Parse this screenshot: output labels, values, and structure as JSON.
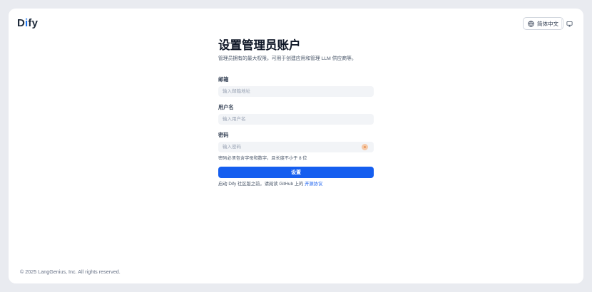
{
  "header": {
    "logo_prefix": "D",
    "logo_accent": "i",
    "logo_suffix": "fy",
    "language_label": "简体中文"
  },
  "form": {
    "title": "设置管理员账户",
    "subtitle": "管理员拥有的最大权限，可用于创建应用和管理 LLM 供应商等。",
    "email": {
      "label": "邮箱",
      "placeholder": "输入邮箱地址",
      "value": ""
    },
    "username": {
      "label": "用户名",
      "placeholder": "输入用户名",
      "value": ""
    },
    "password": {
      "label": "密码",
      "placeholder": "输入密码",
      "value": "",
      "hint": "密码必须包含字母和数字，且长度不小于 8 位"
    },
    "submit_label": "设置",
    "license_prefix": "启动 Dify 社区版之前，请阅读 GitHub 上的",
    "license_link": "开源协议"
  },
  "footer": {
    "copyright": "© 2025 LangGenius, Inc. All rights reserved."
  },
  "colors": {
    "primary": "#155eef",
    "page_bg": "#e9ebf0",
    "input_bg": "#f2f4f7"
  },
  "icons": {
    "language": "globe-icon",
    "theme": "monitor-icon",
    "password_toggle": "eye-icon"
  }
}
